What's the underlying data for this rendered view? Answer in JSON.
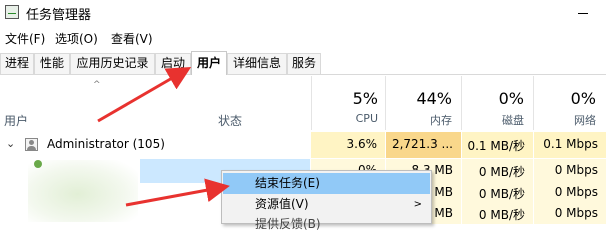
{
  "window": {
    "title": "任务管理器",
    "minimize": "—"
  },
  "menubar": [
    {
      "label": "文件(F)"
    },
    {
      "label": "选项(O)"
    },
    {
      "label": "查看(V)"
    }
  ],
  "tabs": [
    {
      "label": "进程"
    },
    {
      "label": "性能"
    },
    {
      "label": "应用历史记录"
    },
    {
      "label": "启动"
    },
    {
      "label": "用户"
    },
    {
      "label": "详细信息"
    },
    {
      "label": "服务"
    }
  ],
  "active_tab": "用户",
  "header": {
    "sort_arrow": "^",
    "user_col": "用户",
    "status_col": "状态",
    "cpu": {
      "pct": "5%",
      "label": "CPU"
    },
    "memory": {
      "pct": "44%",
      "label": "内存"
    },
    "disk": {
      "pct": "0%",
      "label": "磁盘"
    },
    "network": {
      "pct": "0%",
      "label": "网络"
    }
  },
  "rows": [
    {
      "expand": "⌄",
      "name": "Administrator (105)",
      "cpu": "3.6%",
      "memory": "2,721.3 ...",
      "disk": "0.1 MB/秒",
      "network": "0.1 Mbps"
    },
    {
      "cpu": "0%",
      "memory": "8.3 MB",
      "disk": "0 MB/秒",
      "network": "0 Mbps"
    },
    {
      "memory": "MB",
      "disk": "0 MB/秒",
      "network": "0 Mbps"
    },
    {
      "memory": "MB",
      "disk": "0 MB/秒",
      "network": "0 Mbps"
    }
  ],
  "context_menu": {
    "end_task": "结束任务(E)",
    "resource_values": "资源值(V)",
    "submenu_arrow": ">",
    "partial_item": "提供反馈(B)"
  },
  "colors": {
    "cpu_cell": "#fff4c4",
    "memory_cell": "#f9d78b",
    "selection": "#cce8ff",
    "menu_hover": "#91c9f7",
    "arrow": "#e8322f"
  }
}
